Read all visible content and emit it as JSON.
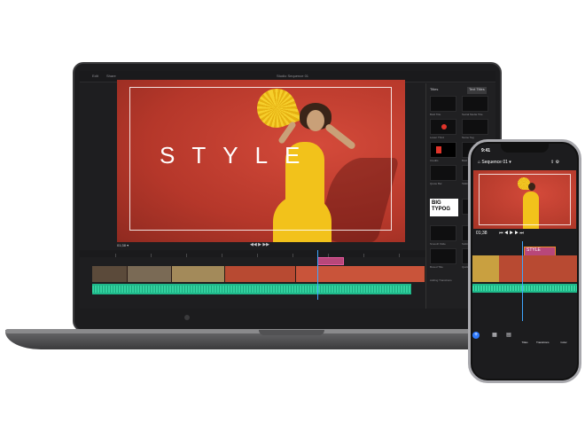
{
  "laptop": {
    "app_title": "Studio Sequence 01",
    "menu": [
      "Edit",
      "Share"
    ],
    "preview_title": "STYLE",
    "timecode": "01;38 ▾",
    "panel": {
      "tabs": [
        "Titles",
        "Text Titles"
      ],
      "thumb_labels": [
        "Bold Title",
        "Social Media Title",
        "Lower Third",
        "Name Tag",
        "Credits",
        "Bold Simple",
        "Quote Bar",
        "Talking Title",
        "Smooth Slide",
        "Subtitle Plate",
        "Boxed Title",
        "Quick Style"
      ],
      "big_thumb_line1": "BIG",
      "big_thumb_line2": "TYPOG",
      "bottom_label": "Adding Transitions"
    }
  },
  "phone": {
    "time": "9:41",
    "back_label": "Sequence 01",
    "timecode": "01;38",
    "title_clip": "STYLE",
    "toolbar": [
      "+",
      "▦",
      "▤",
      "Titles",
      "Transitions",
      "Color"
    ]
  },
  "colors": {
    "wall": "#c43c2f",
    "dress": "#f2c21b",
    "audio_track": "#1fb88a",
    "title_clip": "#b8477a",
    "playhead": "#3ea6ff"
  }
}
